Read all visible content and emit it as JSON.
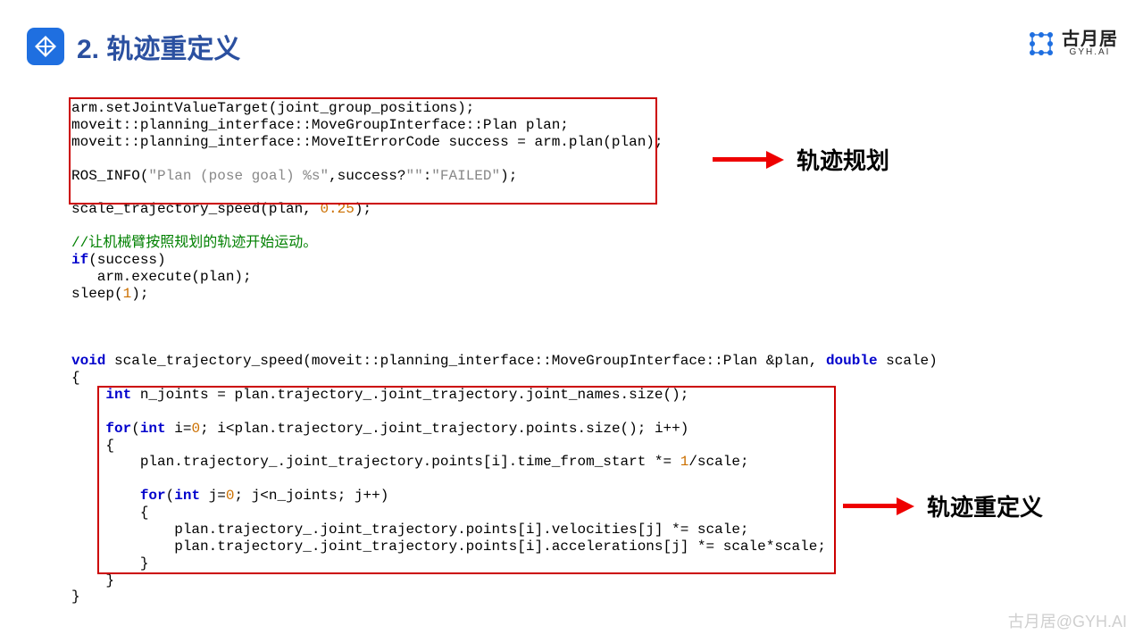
{
  "header": {
    "title": "2. 轨迹重定义"
  },
  "brand": {
    "name": "古月居",
    "sub": "GYH.AI"
  },
  "labels": {
    "planning": "轨迹规划",
    "redefine": "轨迹重定义"
  },
  "code": {
    "l01a": "arm.setJointValueTarget(joint_group_positions);",
    "l02a": "moveit::planning_interface::MoveGroupInterface::Plan plan;",
    "l03a": "moveit::planning_interface::MoveItErrorCode success = arm.plan(plan);",
    "l05a": "ROS_INFO(",
    "l05b": "\"Plan (pose goal) %s\"",
    "l05c": ",success?",
    "l05d": "\"\"",
    "l05e": ":",
    "l05f": "\"FAILED\"",
    "l05g": ");",
    "l07a": "scale_trajectory_speed(plan, ",
    "l07b": "0.25",
    "l07c": ");",
    "l09a": "//让机械臂按照规划的轨迹开始运动。",
    "l10a": "if",
    "l10b": "(success)",
    "l11a": "   arm.execute(plan);",
    "l12a": "sleep(",
    "l12b": "1",
    "l12c": ");",
    "l16a": "void",
    "l16b": " scale_trajectory_speed(moveit::planning_interface::MoveGroupInterface::Plan &plan, ",
    "l16c": "double",
    "l16d": " scale)",
    "l17a": "{",
    "l18a": "    ",
    "l18b": "int",
    "l18c": " n_joints = plan.trajectory_.joint_trajectory.joint_names.size();",
    "l20a": "    ",
    "l20b": "for",
    "l20c": "(",
    "l20d": "int",
    "l20e": " i=",
    "l20f": "0",
    "l20g": "; i<plan.trajectory_.joint_trajectory.points.size(); i++)",
    "l21a": "    {",
    "l22a": "        plan.trajectory_.joint_trajectory.points[i].time_from_start *= ",
    "l22b": "1",
    "l22c": "/scale;",
    "l24a": "        ",
    "l24b": "for",
    "l24c": "(",
    "l24d": "int",
    "l24e": " j=",
    "l24f": "0",
    "l24g": "; j<n_joints; j++)",
    "l25a": "        {",
    "l26a": "            plan.trajectory_.joint_trajectory.points[i].velocities[j] *= scale;",
    "l27a": "            plan.trajectory_.joint_trajectory.points[i].accelerations[j] *= scale*scale;",
    "l28a": "        }",
    "l29a": "    }",
    "l30a": "}"
  },
  "watermark": "古月居@GYH.AI"
}
